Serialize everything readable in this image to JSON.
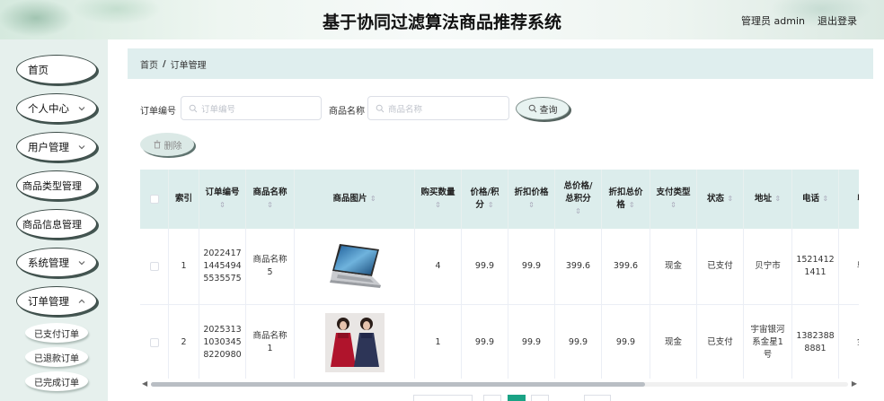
{
  "header": {
    "title": "基于协同过滤算法商品推荐系统",
    "user": "管理员 admin",
    "logout": "退出登录"
  },
  "sidebar": {
    "items": [
      {
        "label": "首页"
      },
      {
        "label": "个人中心"
      },
      {
        "label": "用户管理"
      },
      {
        "label": "商品类型管理"
      },
      {
        "label": "商品信息管理"
      },
      {
        "label": "系统管理"
      },
      {
        "label": "订单管理"
      }
    ],
    "sub_items": [
      {
        "label": "已支付订单"
      },
      {
        "label": "已退款订单"
      },
      {
        "label": "已完成订单"
      }
    ]
  },
  "breadcrumb": {
    "home": "首页",
    "sep": "/",
    "current": "订单管理"
  },
  "search": {
    "order_no_label": "订单编号",
    "order_no_placeholder": "订单编号",
    "product_name_label": "商品名称",
    "product_name_placeholder": "商品名称",
    "query_label": "查询"
  },
  "toolbar": {
    "delete_label": "删除"
  },
  "table": {
    "headers": {
      "index": "索引",
      "order_no": "订单编号",
      "product_name": "商品名称",
      "image": "商品图片",
      "quantity": "购买数量",
      "price_a": "价格/积",
      "price_b": "分",
      "discount_price": "折扣价格",
      "total_a": "总价格/",
      "total_b": "总积分",
      "discount_total_a": "折扣总价",
      "discount_total_b": "格",
      "pay_type": "支付类型",
      "status": "状态",
      "address": "地址",
      "phone": "电话",
      "receiver": "收"
    },
    "rows": [
      {
        "index": "1",
        "order_no_1": "2022417",
        "order_no_2": "1445494",
        "order_no_3": "5535575",
        "product_name_1": "商品名称",
        "product_name_2": "5",
        "quantity": "4",
        "price": "99.9",
        "discount_price": "99.9",
        "total": "399.6",
        "discount_total": "399.6",
        "pay_type": "现金",
        "status": "已支付",
        "address_1": "贝宁市",
        "phone_1": "1521412",
        "phone_2": "1411",
        "receiver": "邬"
      },
      {
        "index": "2",
        "order_no_1": "2025313",
        "order_no_2": "1030345",
        "order_no_3": "8220980",
        "product_name_1": "商品名称",
        "product_name_2": "1",
        "quantity": "1",
        "price": "99.9",
        "discount_price": "99.9",
        "total": "99.9",
        "discount_total": "99.9",
        "pay_type": "现金",
        "status": "已支付",
        "address_1": "宇宙银河",
        "address_2": "系金星1",
        "address_3": "号",
        "phone_1": "1382388",
        "phone_2": "8881",
        "receiver": "金"
      }
    ]
  },
  "sort_glyph": "⇕",
  "sort_icon": "sort-caret-icon",
  "colors": {
    "accent": "#1aa385",
    "header_bg": "#dcedec",
    "sidebar_bg": "#e6f0ed"
  }
}
